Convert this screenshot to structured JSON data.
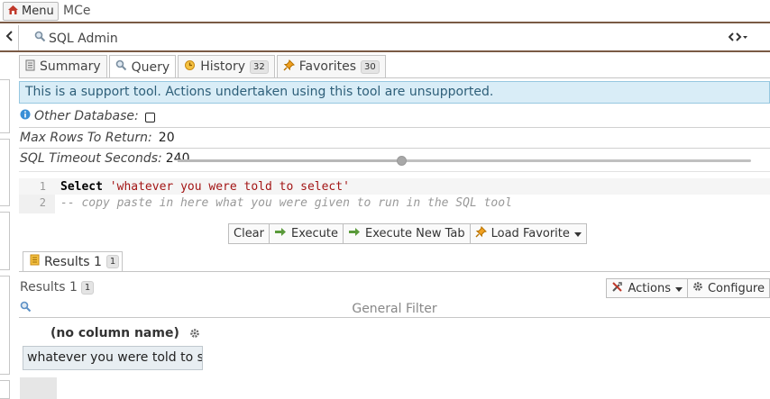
{
  "topbar": {
    "menu_label": "Menu",
    "app_name": "MCe"
  },
  "header": {
    "breadcrumb": "SQL Admin"
  },
  "tabs": [
    {
      "label": "Summary",
      "icon": "document-icon",
      "badge": ""
    },
    {
      "label": "Query",
      "icon": "magnifier-icon",
      "badge": ""
    },
    {
      "label": "History",
      "icon": "clock-icon",
      "badge": "32"
    },
    {
      "label": "Favorites",
      "icon": "pin-icon",
      "badge": "30"
    }
  ],
  "notice": "This is a support tool. Actions undertaken using this tool are unsupported.",
  "form": {
    "other_db_label": "Other Database:",
    "max_rows_label": "Max Rows To Return:",
    "max_rows_value": "20",
    "timeout_label": "SQL Timeout Seconds:",
    "timeout_value": "240",
    "timeout_slider_fraction": 0.39
  },
  "editor": {
    "line_numbers": [
      "1",
      "2"
    ],
    "line1_keyword": "Select",
    "line1_string": "'whatever you were told to select'",
    "line2_comment": "-- copy paste in here what you were given to run in the SQL tool"
  },
  "buttons": {
    "clear": "Clear",
    "execute": "Execute",
    "execute_new_tab": "Execute New Tab",
    "load_favorite": "Load Favorite"
  },
  "results": {
    "tab_label": "Results 1",
    "tab_badge": "1",
    "heading": "Results 1",
    "heading_badge": "1",
    "actions_label": "Actions",
    "configure_label": "Configure",
    "filter_label": "General Filter",
    "column_header": "(no column name)",
    "cell_value": "whatever you were told to s..."
  },
  "colors": {
    "accent_border": "#7a5a45",
    "notice_bg": "#d9edf7",
    "notice_text": "#2e5f79"
  }
}
